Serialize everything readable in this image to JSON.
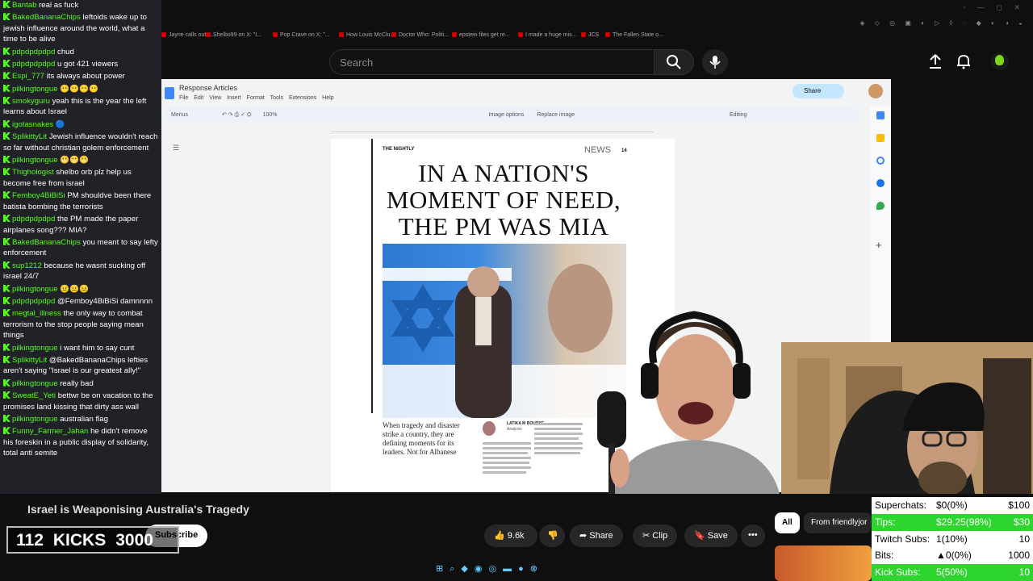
{
  "browser": {
    "tabs": [
      "Jayne calls out J...",
      "Shelbo99 on X: \"I...",
      "Pop Crave on X: \"...",
      "How Louis McClu...",
      "Doctor Who: Politi...",
      "epstein files get re...",
      "I made a huge mis...",
      "JCS",
      "The Fallen State o..."
    ]
  },
  "youtube": {
    "search_placeholder": "Search",
    "video_title": "Israel is Weaponising Australia's Tragedy",
    "subscribe_label": "Subscribe",
    "like_count": "9.6k",
    "share_label": "Share",
    "clip_label": "Clip",
    "save_label": "Save",
    "chips": [
      "All",
      "From friendlyjor"
    ]
  },
  "docs": {
    "title": "Response Articles",
    "menu": "File  Edit  View  Insert  Format  Tools  Extensions  Help",
    "toolbar_menus": "Menus",
    "zoom": "100%",
    "image_options": "Image options",
    "replace_image": "Replace image",
    "editing": "Editing",
    "share": "Share"
  },
  "article": {
    "masthead": "THE NIGHTLY",
    "section": "NEWS",
    "page_number": "14",
    "headline": "IN A NATION'S MOMENT OF NEED, THE PM WAS MIA",
    "lede": "When tragedy and disaster strike a country, they are defining moments for its leaders. Not for Albanese",
    "author": "LATIKA M BOURKE",
    "author_role": "Analysis"
  },
  "chat": [
    {
      "user": "Bantab",
      "text": "real as fuck"
    },
    {
      "user": "BakedBananaChips",
      "text": "leftoids wake up to jewish influence around the world, what a time to be alive"
    },
    {
      "user": "pdpdpdpdpd",
      "text": "chud"
    },
    {
      "user": "pdpdpdpdpd",
      "text": "u got 421 viewers"
    },
    {
      "user": "Espi_777",
      "text": "its always about power"
    },
    {
      "user": "pilkingtongue",
      "text": ""
    },
    {
      "user": "smokyguru",
      "text": "yeah this is the year the left learns about Israel"
    },
    {
      "user": "igotasnakes",
      "text": ""
    },
    {
      "user": "SplikittyLit",
      "text": "Jewish influence wouldn't reach so far without christian golem enforcement"
    },
    {
      "user": "pilkingtongue",
      "text": ""
    },
    {
      "user": "Thighologist",
      "text": "shelbo orb plz help us become free from israel"
    },
    {
      "user": "Femboy4BiBiSi",
      "text": "PM shouldve been there batista bombing the terrorists"
    },
    {
      "user": "pdpdpdpdpd",
      "text": "the PM made the paper airplanes song??? MIA?"
    },
    {
      "user": "BakedBananaChips",
      "text": "you meant to say lefty enforcement"
    },
    {
      "user": "sup1212",
      "text": "because he wasnt sucking off israel 24/7"
    },
    {
      "user": "pilkingtongue",
      "text": ""
    },
    {
      "user": "pdpdpdpdpd",
      "text": "@Femboy4BiBiSi damnnnn"
    },
    {
      "user": "megtal_illness",
      "text": "the only way to combat terrorism to the stop people saying mean things"
    },
    {
      "user": "pilkingtongue",
      "text": "i want him to say cunt"
    },
    {
      "user": "SplikittyLit",
      "text": "@BakedBananaChips lefties aren't saying \"Israel is our greatest ally!\""
    },
    {
      "user": "pilkingtongue",
      "text": "really bad"
    },
    {
      "user": "SweatE_Yeti",
      "text": "bettwr be on vacation to the promises land kissing that dirty ass wall"
    },
    {
      "user": "pilkingtongue",
      "text": "australian flag"
    },
    {
      "user": "Funny_Farmer_Jahan",
      "text": "he didn't remove his foreskin in a public display of solidarity, total anti semite"
    }
  ],
  "kicks_counter": {
    "current": "112",
    "label": "KICKS",
    "goal": "3000"
  },
  "stats": [
    {
      "label": "Superchats:",
      "value": "$0(0%)",
      "goal": "$100",
      "highlight": false
    },
    {
      "label": "Tips:",
      "value": "$29.25(98%)",
      "goal": "$30",
      "highlight": true
    },
    {
      "label": "Twitch Subs:",
      "value": "1(10%)",
      "goal": "10",
      "highlight": false
    },
    {
      "label": "Bits:",
      "value": "0(0%)",
      "goal": "1000",
      "highlight": false
    },
    {
      "label": "Kick Subs:",
      "value": "5(50%)",
      "goal": "10",
      "highlight": true
    }
  ],
  "colors": {
    "kick_green": "#53fc18",
    "stats_highlight": "#2fd52f",
    "docs_blue": "#4285f4"
  }
}
